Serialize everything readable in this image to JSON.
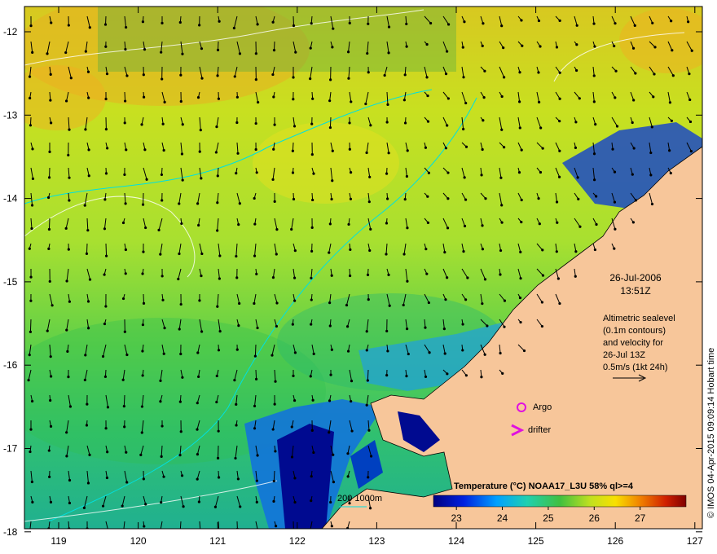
{
  "map": {
    "lon_ticks": [
      "119",
      "120",
      "121",
      "122",
      "123",
      "124",
      "125",
      "126",
      "127"
    ],
    "lat_ticks": [
      "-12",
      "-13",
      "-14",
      "-15",
      "-16",
      "-17",
      "-18"
    ],
    "date_line1": "26-Jul-2006",
    "date_line2": "13:51Z",
    "note_lines": [
      "Altimetric sealevel",
      "(0.1m contours)",
      "and velocity for",
      "26-Jul 13Z",
      "0.5m/s (1kt 24h)"
    ],
    "argo_label": "Argo",
    "drifter_label": "drifter",
    "depth_label": "200  1000m",
    "credit": "© IMOS 04-Apr-2015 09:09:14 Hobart time",
    "colors": {
      "land": "#f7c69a",
      "argo": "#e010e0",
      "sst_warm": "#e8a020",
      "sst_cold": "#0a14a0"
    }
  },
  "legend": {
    "title": "Temperature (°C) NOAA17_L3U 58% ql>=4",
    "ticks": [
      "23",
      "24",
      "25",
      "26",
      "27"
    ],
    "range": [
      22.5,
      28
    ]
  }
}
